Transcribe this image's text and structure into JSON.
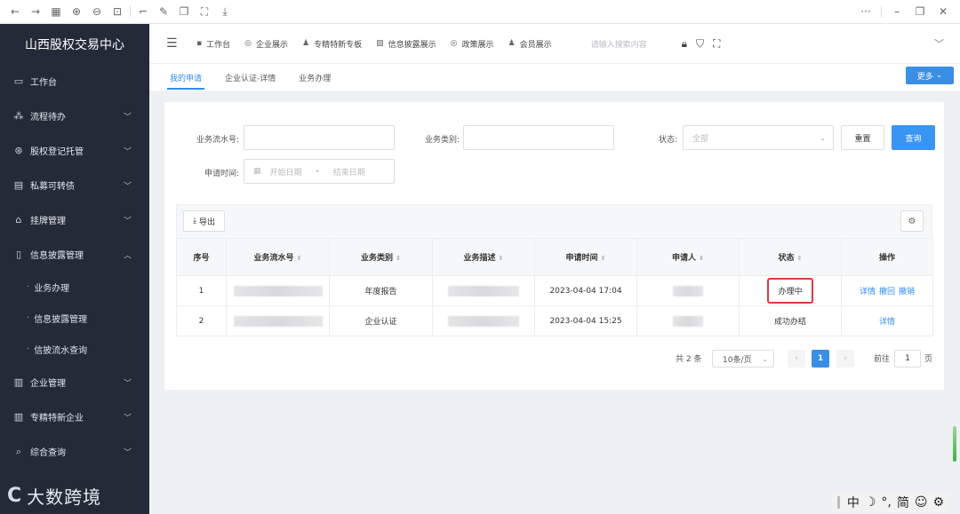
{
  "browser": {
    "icons": [
      "back-icon",
      "forward-icon",
      "apps-icon",
      "zoom-in-icon",
      "zoom-out-icon",
      "fit-icon",
      "crop-icon",
      "edit-icon",
      "copy-icon",
      "capture-icon",
      "download-icon"
    ],
    "menu_dots": "···"
  },
  "sidebar": {
    "brand": "山西股权交易中心",
    "items": [
      {
        "label": "工作台",
        "icon": "monitor-icon",
        "icon_glyph": "▭",
        "expandable": false
      },
      {
        "label": "流程待办",
        "icon": "flow-icon",
        "icon_glyph": "⁂",
        "expandable": true
      },
      {
        "label": "股权登记托管",
        "icon": "badge-icon",
        "icon_glyph": "⊛",
        "expandable": true
      },
      {
        "label": "私募可转债",
        "icon": "doc-icon",
        "icon_glyph": "▤",
        "expandable": true
      },
      {
        "label": "挂牌管理",
        "icon": "bag-icon",
        "icon_glyph": "⌂",
        "expandable": true
      },
      {
        "label": "信息披露管理",
        "icon": "file-icon",
        "icon_glyph": "▯",
        "expandable": true,
        "expanded": true
      }
    ],
    "subitems": [
      "业务办理",
      "信息披露管理",
      "信披流水查询"
    ],
    "items2": [
      {
        "label": "企业管理",
        "icon": "building-icon",
        "icon_glyph": "▥",
        "expandable": true
      },
      {
        "label": "专精特新企业",
        "icon": "building2-icon",
        "icon_glyph": "▥",
        "expandable": true
      },
      {
        "label": "综合查询",
        "icon": "search-icon",
        "icon_glyph": "⌕",
        "expandable": true
      }
    ],
    "watermark": "大数跨境"
  },
  "topnav": {
    "links": [
      {
        "label": "工作台",
        "glyph": "▪"
      },
      {
        "label": "企业展示",
        "glyph": "◎"
      },
      {
        "label": "专精特新专板",
        "glyph": "♟"
      },
      {
        "label": "信息披露展示",
        "glyph": "▨"
      },
      {
        "label": "政策展示",
        "glyph": "◎"
      },
      {
        "label": "会员展示",
        "glyph": "♟"
      }
    ],
    "search_placeholder": "请输入搜索内容"
  },
  "tabs": {
    "items": [
      "我的申请",
      "企业认证-详情",
      "业务办理"
    ],
    "active": 0,
    "more_label": "更多"
  },
  "form": {
    "serial_label": "业务流水号:",
    "category_label": "业务类别:",
    "status_label": "状态:",
    "status_value": "全部",
    "time_label": "申请时间:",
    "start_placeholder": "开始日期",
    "end_placeholder": "结束日期",
    "range_sep": "-",
    "reset_label": "重置",
    "query_label": "查询"
  },
  "toolbar": {
    "export_label": "导出"
  },
  "table": {
    "columns": [
      "序号",
      "业务流水号",
      "业务类别",
      "业务描述",
      "申请时间",
      "申请人",
      "状态",
      "操作"
    ],
    "rows": [
      {
        "index": "1",
        "category": "年度报告",
        "time": "2023-04-04 17:04",
        "status": "办理中",
        "actions": [
          "详情",
          "撤回",
          "撤销"
        ]
      },
      {
        "index": "2",
        "category": "企业认证",
        "time": "2023-04-04 15:25",
        "status": "成功办结",
        "actions": [
          "详情"
        ]
      }
    ]
  },
  "pager": {
    "total": "共 2 条",
    "page_size": "10条/页",
    "current": "1",
    "goto_label": "前往",
    "goto_value": "1",
    "goto_unit": "页"
  },
  "ime": {
    "mode": "中",
    "simplified": "简"
  },
  "colors": {
    "primary": "#2f8cf0",
    "sidebar_bg": "#232b39",
    "highlight_border": "#e03a3a"
  }
}
